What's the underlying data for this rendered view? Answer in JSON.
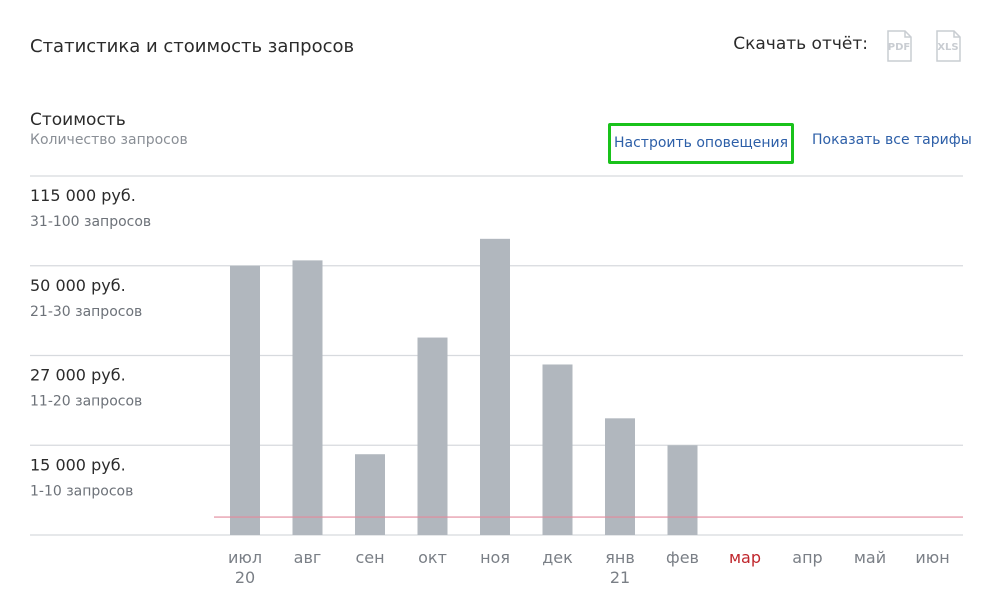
{
  "header": {
    "title": "Статистика и стоимость запросов",
    "download_label": "Скачать отчёт:",
    "pdf_label": "PDF",
    "xls_label": "XLS"
  },
  "section": {
    "title": "Стоимость",
    "subtitle": "Количество запросов",
    "notify_link": "Настроить оповещения",
    "tariffs_link": "Показать все тарифы"
  },
  "colors": {
    "bar": "#b1b7be",
    "grid": "#d7dade",
    "threshold": "#e28a9c",
    "highlight_month": "#c0262c",
    "axis_text": "#7a7f86",
    "link": "#2d5fa8",
    "focus_border": "#19c21b"
  },
  "chart_data": {
    "type": "bar",
    "categories": [
      "июл",
      "авг",
      "сен",
      "окт",
      "ноя",
      "дек",
      "янв",
      "фев",
      "мар",
      "апр",
      "май",
      "июн"
    ],
    "year_labels": {
      "0": "20",
      "6": "21"
    },
    "highlighted_category": "мар",
    "tiers": [
      {
        "price": "15 000 руб.",
        "requests": "1-10 запросов"
      },
      {
        "price": "27 000 руб.",
        "requests": "11-20 запросов"
      },
      {
        "price": "50 000 руб.",
        "requests": "21-30 запросов"
      },
      {
        "price": "115 000 руб.",
        "requests": "31-100 запросов"
      }
    ],
    "values": [
      30,
      30.6,
      9,
      22,
      33,
      19,
      13,
      10,
      null,
      null,
      null,
      null
    ],
    "y_unit": "запросов",
    "threshold": 2,
    "ylim": [
      0,
      40
    ],
    "grid": true
  }
}
